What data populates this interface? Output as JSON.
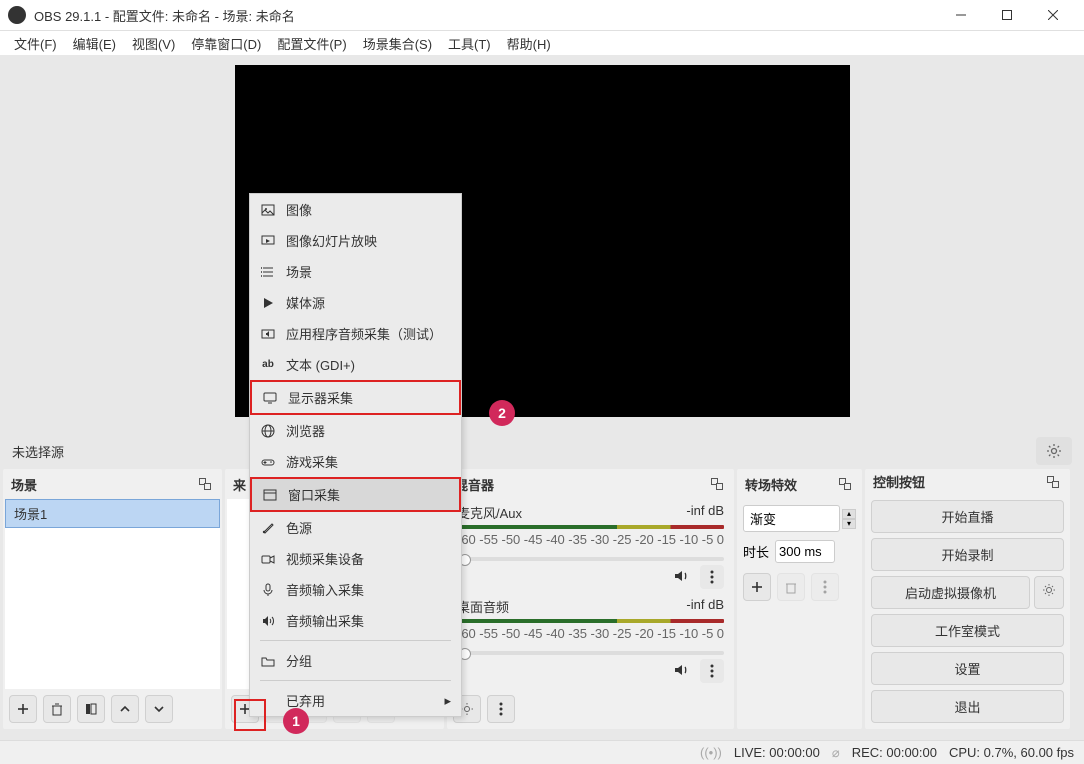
{
  "titlebar": {
    "app": "OBS 29.1.1 - 配置文件: 未命名 - 场景: 未命名"
  },
  "menubar": {
    "file": "文件(F)",
    "edit": "编辑(E)",
    "view": "视图(V)",
    "docks": "停靠窗口(D)",
    "profile": "配置文件(P)",
    "scene_collection": "场景集合(S)",
    "tools": "工具(T)",
    "help": "帮助(H)"
  },
  "no_source_label": "未选择源",
  "panels": {
    "scenes": {
      "title": "场景",
      "item1": "场景1"
    },
    "sources": {
      "title": "来"
    },
    "mixer": {
      "title": "混音器",
      "mic": {
        "label": "麦克风/Aux",
        "db": "-inf dB"
      },
      "desktop": {
        "label": "桌面音频",
        "db": "-inf dB"
      },
      "ticks": [
        "-60",
        "-55",
        "-50",
        "-45",
        "-40",
        "-35",
        "-30",
        "-25",
        "-20",
        "-15",
        "-10",
        "-5",
        "0"
      ]
    },
    "transitions": {
      "title": "转场特效",
      "type": "渐变",
      "dur_label": "时长",
      "dur": "300 ms"
    },
    "controls": {
      "title": "控制按钮",
      "start_stream": "开始直播",
      "start_record": "开始录制",
      "start_vcam": "启动虚拟摄像机",
      "studio": "工作室模式",
      "settings": "设置",
      "exit": "退出"
    }
  },
  "context_menu": {
    "image": "图像",
    "slideshow": "图像幻灯片放映",
    "scene": "场景",
    "media": "媒体源",
    "app_audio": "应用程序音频采集（测试）",
    "text_gdi": "文本 (GDI+)",
    "display_capture": "显示器采集",
    "browser": "浏览器",
    "game_capture": "游戏采集",
    "window_capture": "窗口采集",
    "color_source": "色源",
    "video_capture": "视频采集设备",
    "audio_input": "音频输入采集",
    "audio_output": "音频输出采集",
    "group": "分组",
    "deprecated": "已弃用"
  },
  "statusbar": {
    "live": "LIVE: 00:00:00",
    "rec": "REC: 00:00:00",
    "cpu": "CPU: 0.7%, 60.00 fps"
  },
  "annotations": {
    "badge1": "1",
    "badge2": "2"
  }
}
